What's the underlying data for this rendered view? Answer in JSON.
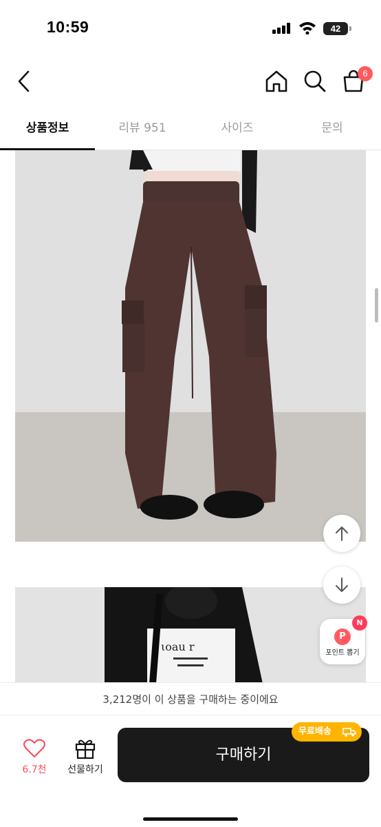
{
  "status_bar": {
    "time": "10:59",
    "battery": "42"
  },
  "nav": {
    "back_icon": "chevron-left-icon",
    "home_icon": "home-icon",
    "search_icon": "search-icon",
    "cart_icon": "cart-bag-icon",
    "cart_count": "6"
  },
  "tabs": [
    {
      "label": "상품정보",
      "active": true
    },
    {
      "label": "리뷰 951",
      "active": false
    },
    {
      "label": "사이즈",
      "active": false
    },
    {
      "label": "문의",
      "active": false
    }
  ],
  "floating": {
    "scroll_up_icon": "arrow-up-icon",
    "scroll_down_icon": "arrow-down-icon",
    "point_icon_letter": "P",
    "point_label": "포인트 뽑기",
    "point_badge": "N"
  },
  "purchase_info": "3,212명이 이 상품을 구매하는 중이에요",
  "bottom_bar": {
    "like_count": "6.7천",
    "gift_label": "선물하기",
    "buy_label": "구매하기",
    "shipping_badge": "무료배송"
  },
  "colors": {
    "accent_red": "#ff5a5f",
    "buy_button": "#1a1a1a",
    "shipping_badge": "#ffb400"
  }
}
